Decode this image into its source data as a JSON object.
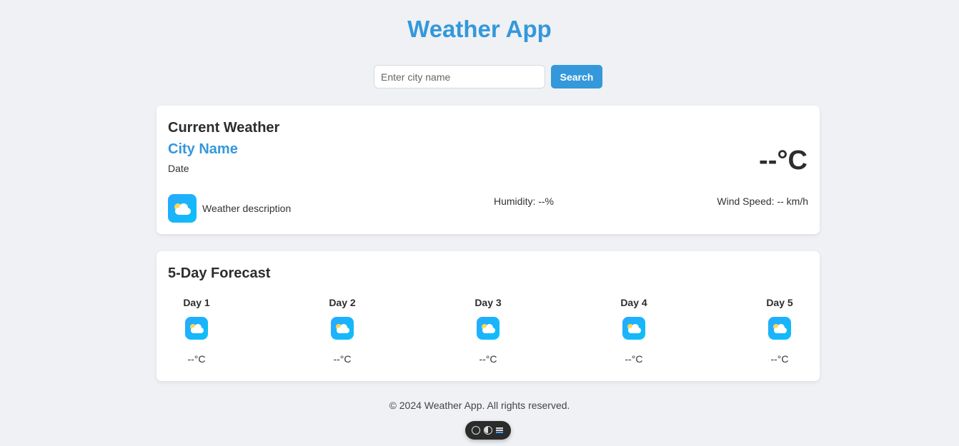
{
  "header": {
    "title": "Weather App"
  },
  "search": {
    "placeholder": "Enter city name",
    "value": "",
    "button_label": "Search"
  },
  "current": {
    "heading": "Current Weather",
    "city": "City Name",
    "date": "Date",
    "temperature": "--°C",
    "icon": "sun-cloud-icon",
    "description": "Weather description",
    "humidity": "Humidity: --%",
    "wind": "Wind Speed: -- km/h"
  },
  "forecast": {
    "heading": "5-Day Forecast",
    "days": [
      {
        "label": "Day 1",
        "temp": "--°C",
        "icon": "sun-cloud-icon"
      },
      {
        "label": "Day 2",
        "temp": "--°C",
        "icon": "sun-cloud-icon"
      },
      {
        "label": "Day 3",
        "temp": "--°C",
        "icon": "sun-cloud-icon"
      },
      {
        "label": "Day 4",
        "temp": "--°C",
        "icon": "sun-cloud-icon"
      },
      {
        "label": "Day 5",
        "temp": "--°C",
        "icon": "sun-cloud-icon"
      }
    ]
  },
  "footer": {
    "text": "© 2024 Weather App. All rights reserved."
  },
  "toolbar": {
    "icons": [
      "chat-icon",
      "toggle-icon",
      "menu-icon"
    ]
  },
  "colors": {
    "accent": "#3498db",
    "background": "#eff1f5",
    "card": "#ffffff",
    "icon_gradient_start": "#29a8ff",
    "icon_gradient_end": "#0bc0f7"
  }
}
